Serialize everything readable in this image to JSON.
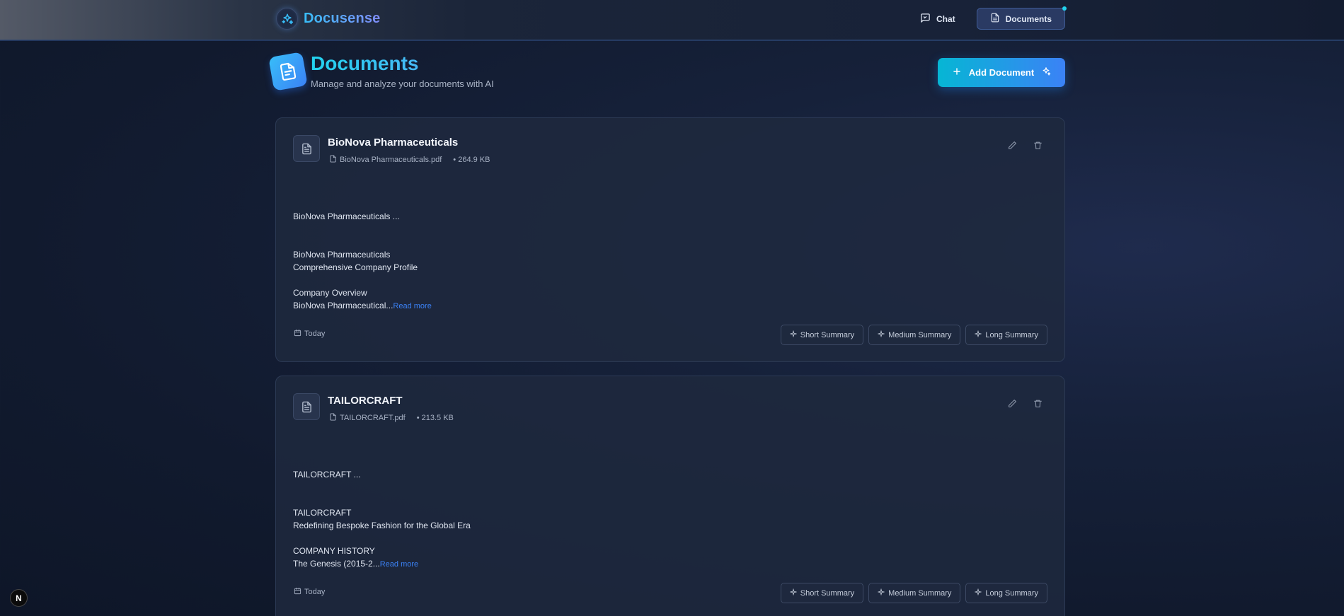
{
  "app": {
    "name": "Docusense"
  },
  "nav": {
    "chat": "Chat",
    "documents": "Documents"
  },
  "header": {
    "title": "Documents",
    "subtitle": "Manage and analyze your documents with AI",
    "add_button": "Add Document"
  },
  "documents": [
    {
      "title": "BioNova Pharmaceuticals",
      "filename": "BioNova Pharmaceuticals.pdf",
      "size": "• 264.9 KB",
      "preview": [
        "BioNova Pharmaceuticals ...",
        "",
        "",
        "BioNova Pharmaceuticals",
        "Comprehensive Company Profile",
        "",
        "Company Overview",
        "BioNova Pharmaceutical..."
      ],
      "read_more": "Read more",
      "date": "Today",
      "summaries": [
        "Short Summary",
        "Medium Summary",
        "Long Summary"
      ]
    },
    {
      "title": "TAILORCRAFT",
      "filename": "TAILORCRAFT.pdf",
      "size": "• 213.5 KB",
      "preview": [
        "TAILORCRAFT ...",
        "",
        "",
        "TAILORCRAFT",
        "Redefining Bespoke Fashion for the Global Era",
        "",
        "COMPANY HISTORY",
        "The Genesis (2015-2..."
      ],
      "read_more": "Read more",
      "date": "Today",
      "summaries": [
        "Short Summary",
        "Medium Summary",
        "Long Summary"
      ]
    }
  ],
  "corner_badge": "N",
  "icons": {
    "brand": "sparkles-icon",
    "chat": "message-square-icon",
    "documents": "file-text-icon",
    "add": "plus-icon",
    "add_sparkle": "sparkles-icon",
    "file": "file-text-icon",
    "file_small": "file-icon",
    "edit": "pencil-icon",
    "delete": "trash-icon",
    "calendar": "calendar-icon",
    "summary": "sparkle-icon"
  },
  "colors": {
    "accent": "#38bdf8",
    "primary": "#3b82f6",
    "link": "#3b82f6"
  }
}
